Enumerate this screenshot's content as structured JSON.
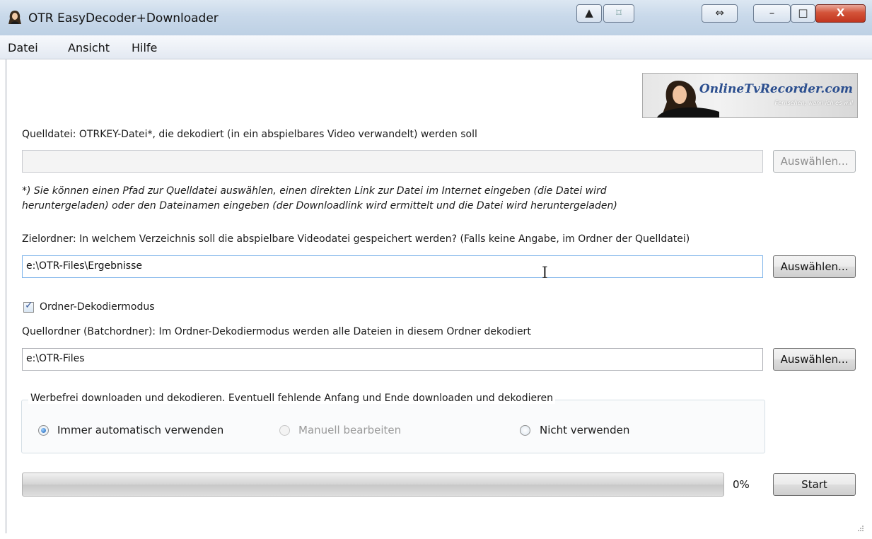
{
  "window": {
    "title": "OTR EasyDecoder+Downloader"
  },
  "menu": {
    "items": [
      "Datei",
      "Ansicht",
      "Hilfe"
    ]
  },
  "logo": {
    "brand": "OnlineTvRecorder.com",
    "tagline": "Fernsehen, wann ich es will"
  },
  "source": {
    "label": "Quelldatei: OTRKEY-Datei*, die dekodiert (in ein abspielbares Video verwandelt) werden soll",
    "value": "",
    "browse_label": "Auswählen...",
    "hint_line1": "*) Sie können einen Pfad zur Quelldatei auswählen, einen direkten Link zur Datei im Internet eingeben (die Datei wird",
    "hint_line2": "heruntergeladen) oder den Dateinamen eingeben (der Downloadlink wird ermittelt und die Datei wird heruntergeladen)"
  },
  "target": {
    "label": "Zielordner: In welchem Verzeichnis soll die abspielbare Videodatei gespeichert werden? (Falls keine Angabe, im Ordner der Quelldatei)",
    "value": "e:\\OTR-Files\\Ergebnisse",
    "browse_label": "Auswählen..."
  },
  "folder_mode": {
    "label": "Ordner-Dekodiermodus",
    "checked": true
  },
  "batch": {
    "label": "Quellordner (Batchordner): Im Ordner-Dekodiermodus werden alle Dateien in diesem Ordner dekodiert",
    "value": "e:\\OTR-Files",
    "browse_label": "Auswählen..."
  },
  "adfree": {
    "title": "Werbefrei downloaden und dekodieren. Eventuell fehlende Anfang und Ende downloaden und dekodieren",
    "options": [
      {
        "label": "Immer automatisch verwenden",
        "checked": true,
        "disabled": false
      },
      {
        "label": "Manuell bearbeiten",
        "checked": false,
        "disabled": true
      },
      {
        "label": "Nicht verwenden",
        "checked": false,
        "disabled": false
      }
    ]
  },
  "progress": {
    "value": 0,
    "text": "0%"
  },
  "start_label": "Start",
  "colors": {
    "titlebar": "#c9d9ea",
    "close_button": "#c1351e",
    "progress_fill": "#3fbf3f"
  }
}
